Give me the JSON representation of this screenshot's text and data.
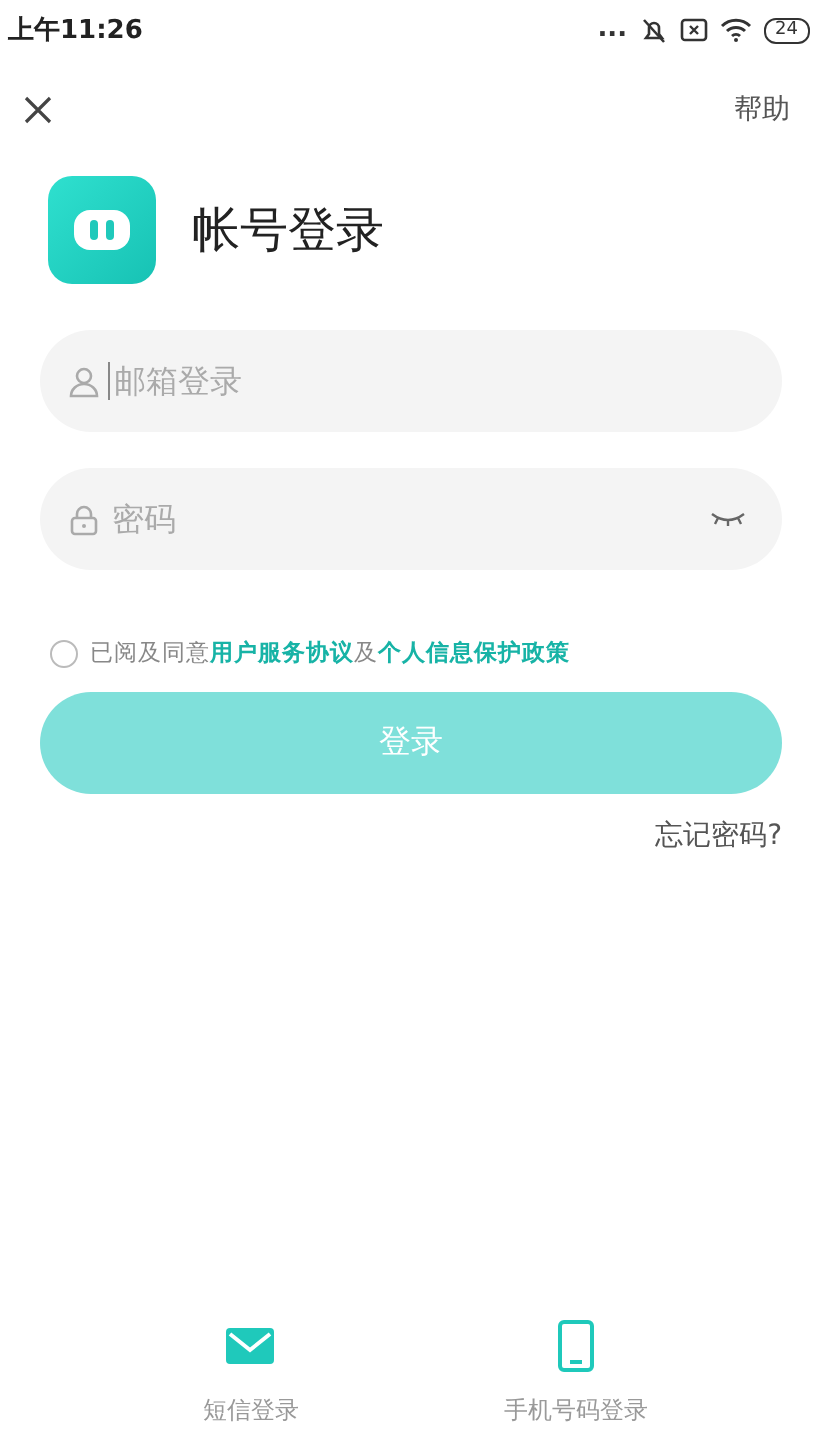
{
  "status_bar": {
    "time": "上午11:26",
    "dots": "...",
    "battery": "24"
  },
  "top_bar": {
    "help": "帮助"
  },
  "header": {
    "title": "帐号登录"
  },
  "fields": [
    {
      "kind": "account",
      "placeholder": "邮箱登录",
      "focused": true
    },
    {
      "kind": "password",
      "placeholder": "密码",
      "focused": false
    }
  ],
  "agreement": {
    "checked": false,
    "parts": [
      {
        "text": "已阅及同意",
        "link": false
      },
      {
        "text": "用户服务协议",
        "link": true
      },
      {
        "text": "及",
        "link": false
      },
      {
        "text": "个人信息保护政策",
        "link": true
      }
    ]
  },
  "login_button": {
    "label": "登录",
    "disabled": true
  },
  "forgot": "忘记密码?",
  "bottom_options": [
    {
      "kind": "sms",
      "label": "短信登录"
    },
    {
      "kind": "phone",
      "label": "手机号码登录"
    }
  ]
}
